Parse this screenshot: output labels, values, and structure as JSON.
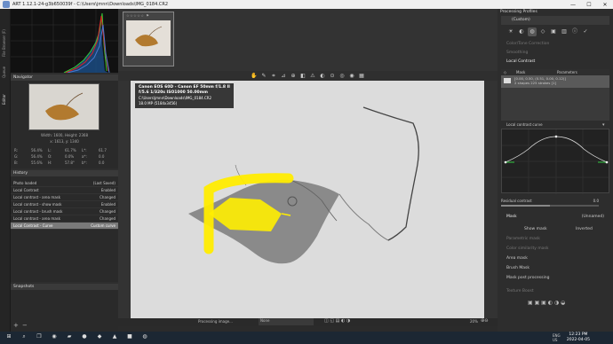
{
  "window": {
    "title": "ART 1.12.1-24-g3b650039f - C:\\Users\\jmnn\\Downloads\\IMG_0184.CR2",
    "minimize": "—",
    "maximize": "☐",
    "close": "✕"
  },
  "vtabs": [
    "File Browser (F)",
    "Queue",
    "Editor"
  ],
  "navigator": {
    "title": "Navigator",
    "size_line": "Width: 1600, Height: 2368",
    "coord_line": "x: 1613, y: 1340",
    "values": [
      [
        "R:",
        "56.4%",
        "L:",
        "61.7%",
        "L*:",
        "61.7"
      ],
      [
        "G:",
        "56.4%",
        "O:",
        "0.0%",
        "a*:",
        "0.0"
      ],
      [
        "B:",
        "55.6%",
        "H:",
        "57.8°",
        "b*:",
        "0.0"
      ]
    ]
  },
  "history": {
    "title": "History",
    "rows": [
      {
        "label": "Photo loaded",
        "value": "(Last Saved)"
      },
      {
        "label": "Local Contrast",
        "value": "Enabled"
      },
      {
        "label": "Local contrast - area mask",
        "value": "Changed"
      },
      {
        "label": "Local contrast - show mask",
        "value": "Enabled"
      },
      {
        "label": "Local contrast - brush mask",
        "value": "Changed"
      },
      {
        "label": "Local contrast - area mask",
        "value": "Changed"
      },
      {
        "label": "Local Contrast - Curve",
        "value": "Custom curve"
      }
    ]
  },
  "snapshots": {
    "title": "Snapshots"
  },
  "exif": {
    "line1": "Canon EOS 60D  -  Canon EF 50mm f/1.8 II",
    "line2": "f/5.6  1/320s  ISO1000  50.00mm",
    "line3": "C:\\Users\\jmnn\\Downloads\\IMG_0184.CR2",
    "line4": "18.0 MP (5184x3456)"
  },
  "statusbar": {
    "processing": "Processing image...",
    "preset": "None",
    "zoom": "20%"
  },
  "right": {
    "title": "Processing Profiles",
    "profile": "(Custom)",
    "items": [
      "Color/Tone Correction",
      "Smoothing",
      "Local Contrast"
    ],
    "mask_header": "Mask",
    "params_header": "Parameters",
    "mask_row_params": "[0.00, 0.50, (0.51, 0.00, 0.12)]",
    "mask_row_sub": "[1]",
    "mask_row_label": "2 shapes 225 strokes",
    "curve_label": "Local contrast curve",
    "residual_label": "Residual contrast",
    "residual_value": "0.0",
    "mask_section": "Mask",
    "mask_mode": "(Unnamed)",
    "show_mask": "Show mask",
    "inverted": "Inverted",
    "param_mask": "Parametric mask",
    "color_mask": "Color similarity mask",
    "area_mask": "Area mask",
    "brush_mask": "Brush Mask",
    "post": "Mask post processing",
    "texture": "Texture Boost"
  },
  "clock": {
    "time": "12:23 PM",
    "date": "2022-04-05",
    "lang": "ENG US"
  }
}
